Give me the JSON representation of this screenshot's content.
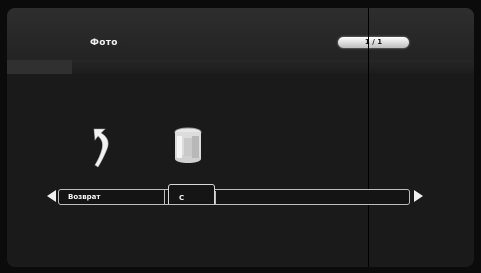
{
  "header": {
    "title": "Фото",
    "counter": "1 / 1"
  },
  "toolbar": {
    "back_label": "Возврат",
    "selected_label": "C"
  },
  "icons": {
    "back": "back-arrow-icon",
    "delete": "trash-icon",
    "nav_left": "triangle-left-icon",
    "nav_right": "triangle-right-icon"
  },
  "colors": {
    "background": "#1a1a1a",
    "text": "#f2f2f2"
  }
}
